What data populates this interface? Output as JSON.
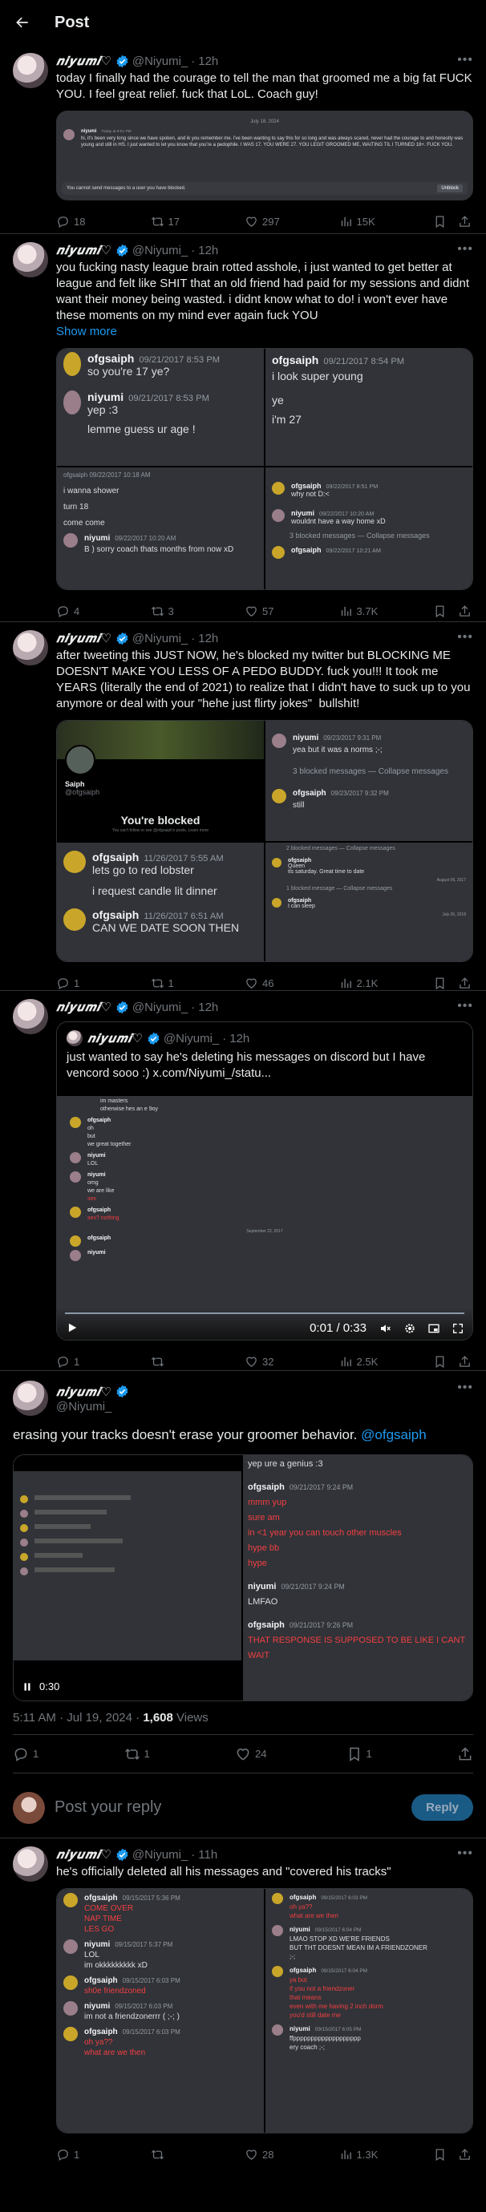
{
  "header": {
    "title": "Post"
  },
  "user": {
    "name": "𝒏𝒊𝒚𝒖𝒎𝒊♡",
    "handle": "@Niyumi_"
  },
  "t1": {
    "time": "12h",
    "text": "today I finally had the courage to tell the man that groomed me a big fat FUCK YOU. I feel great relief. fuck that LoL. Coach guy!",
    "date_divider": "July 18, 2024",
    "dm_user": "niyumi",
    "dm_ts": "Today at 9:01 PM",
    "dm_msg": "hi, it's been very long since we have spoken, and ik you remember me. i've been wanting to say this for so long and was always scared, never had the courage to and honestly was young and still in HS. I just wanted to let you know that you're a pedophile. I WAS 17. YOU WERE 27. YOU LEGIT GROOMED ME, WAITING TIL I TURNED 18+. FUCK YOU.",
    "blocked": "You cannot send messages to a user you have blocked.",
    "unblock": "Unblock",
    "replies": "18",
    "reposts": "17",
    "likes": "297",
    "views": "15K"
  },
  "t2": {
    "time": "12h",
    "text": "you fucking nasty league brain rotted asshole, i just wanted to get better at league and felt like SHIT that an old friend had paid for my sessions and didnt want their money being wasted. i didnt know what to do! i won't ever have these moments on my mind ever again fuck YOU",
    "show_more": "Show more",
    "q1": {
      "u1": "ofgsaiph",
      "ts1": "09/21/2017 8:53 PM",
      "m1": "so you're 17 ye?",
      "u2": "niyumi",
      "ts2": "09/21/2017 8:53 PM",
      "m2": "yep :3",
      "m3": "lemme guess ur age !"
    },
    "q2": {
      "u": "ofgsaiph",
      "ts": "09/21/2017 8:54 PM",
      "m1": "i look super young",
      "m2": "ye",
      "m3": "i'm 27"
    },
    "q3": {
      "head": "ofgsaiph   09/22/2017 10:18 AM",
      "m1": "i wanna shower",
      "m2": "turn 18",
      "m3": "come come",
      "u": "niyumi",
      "ts": "09/22/2017 10:20 AM",
      "m4": "B ) sorry coach thats months from now xD"
    },
    "q4": {
      "u1": "ofgsaiph",
      "ts1": "09/22/2017 8:51 PM",
      "m1": "why not D:<",
      "u2": "niyumi",
      "ts2": "09/22/2017 10:20 AM",
      "m2": "wouldnt have a way home xD",
      "sys": "3 blocked messages — Collapse messages",
      "u3": "ofgsaiph",
      "ts3": "09/22/2017 10:21 AM"
    },
    "replies": "4",
    "reposts": "3",
    "likes": "57",
    "views": "3.7K"
  },
  "t3": {
    "time": "12h",
    "text": "after tweeting this JUST NOW, he's blocked my twitter but BLOCKING ME DOESN'T MAKE YOU LESS OF A PEDO BUDDY. fuck you!!! It took me YEARS (literally the end of 2021) to realize that I didn't have to suck up to you anymore or deal with your \"hehe just flirty jokes\"  bullshit!",
    "profile_name": "Saiph",
    "profile_handle": "@ofgsaiph",
    "you_blocked": "You're blocked",
    "blocked_sub": "You can't follow or see @ofgsaiph's posts. Learn more",
    "q2": {
      "u1": "niyumi",
      "ts1": "09/23/2017 9:31 PM",
      "m1": "yea but it was a norms ;-;",
      "sys": "3 blocked messages — Collapse messages",
      "u2": "ofgsaiph",
      "ts2": "09/23/2017 9:32 PM",
      "m2": "still"
    },
    "q3": {
      "u": "ofgsaiph",
      "ts": "11/26/2017 5:55 AM",
      "m1": "lets go to red lobster",
      "m2": "i request candle lit dinner",
      "u2": "ofgsaiph",
      "ts2": "11/26/2017 6:51 AM",
      "m3": "CAN WE DATE SOON THEN"
    },
    "q4": {
      "sys1": "2 blocked messages — Collapse messages",
      "u1": "ofgsaiph",
      "m1": "Queen",
      "m2": "its saturday. Great time to date",
      "d1": "August 06, 2017",
      "sys2": "1 blocked message — Collapse messages",
      "u2": "ofgsaiph",
      "m3": "I can sleep",
      "d2": "July 26, 2018"
    },
    "replies": "1",
    "reposts": "1",
    "likes": "46",
    "views": "2.1K"
  },
  "t4": {
    "time": "12h",
    "quote_time": "12h",
    "quote_text": "just wanted to say he's deleting his messages on discord but I have vencord sooo :) x.com/Niyumi_/statu...",
    "v": {
      "l1": "im masters",
      "l2": "otherwise hes an e 9oy",
      "u1": "ofgsaiph",
      "m1": "oh",
      "m2": "but",
      "m3": "we great together",
      "u2": "niyumi",
      "m4": "LOL",
      "u3": "niyumi",
      "m5": "omg",
      "m6": "we are like",
      "m7": "sex",
      "u4": "ofgsaiph",
      "m8": "sex? nothing",
      "d": "September 22, 2017",
      "u5": "ofgsaiph",
      "u6": "niyumi"
    },
    "video_time": "0:01 / 0:33",
    "replies": "1",
    "reposts": "",
    "likes": "32",
    "views": "2.5K"
  },
  "t5": {
    "text": "erasing your tracks doesn't erase your groomer behavior. ",
    "mention": "@ofgsaiph",
    "video_time": "0:30",
    "right": {
      "top": "yep ure a genius :3",
      "u1": "ofgsaiph",
      "ts1": "09/21/2017 9:24 PM",
      "m1": "mmm yup",
      "m2": "sure am",
      "m3": "in <1 year you can touch other muscles",
      "m4": "hype bb",
      "m5": "hype",
      "u2": "niyumi",
      "ts2": "09/21/2017 9:24 PM",
      "m6": "LMFAO",
      "u3": "ofgsaiph",
      "ts3": "09/21/2017 9:26 PM",
      "m7": "THAT RESPONSE IS SUPPOSED TO BE LIKE I CANT WAIT"
    },
    "stats_time": "5:11 AM · Jul 19, 2024 · ",
    "stats_views": "1,608",
    "stats_views_label": " Views",
    "replies": "1",
    "reposts": "1",
    "likes": "24",
    "bookmarks": "1"
  },
  "reply": {
    "placeholder": "Post your reply",
    "button": "Reply"
  },
  "t6": {
    "time": "11h",
    "text": "he's officially deleted all his messages and \"covered his tracks\"",
    "left": [
      {
        "u": "ofgsaiph",
        "ts": "09/15/2017 5:36 PM",
        "lines": [
          "COME OVER",
          "NAP TIME",
          "LES GO"
        ],
        "red": true
      },
      {
        "u": "niyumi",
        "ts": "09/15/2017 5:37 PM",
        "lines": [
          "LOL",
          "im okkkkkkkkk xD"
        ],
        "red": false
      },
      {
        "u": "ofgsaiph",
        "ts": "09/15/2017 6:03 PM",
        "lines": [
          "sh0e friendzoned"
        ],
        "red": true
      },
      {
        "u": "niyumi",
        "ts": "09/15/2017 6:03 PM",
        "lines": [
          "im not a friendzonerrr ( ;-; )"
        ],
        "red": false
      },
      {
        "u": "ofgsaiph",
        "ts": "09/15/2017 6:03 PM",
        "lines": [
          "oh ya??",
          "what are we then"
        ],
        "red": true
      }
    ],
    "right": [
      {
        "u": "ofgsaiph",
        "ts": "09/15/2017 6:03 PM",
        "lines": [
          "oh ya??",
          "what are we then"
        ],
        "red": true
      },
      {
        "u": "niyumi",
        "ts": "09/15/2017 6:04 PM",
        "lines": [
          "LMAO STOP XD WE'RE FRIENDS",
          "BUT THT DOESNT MEAN IM A FRIENDZONER",
          ";-;"
        ],
        "red": false
      },
      {
        "u": "ofgsaiph",
        "ts": "09/15/2017 6:04 PM",
        "lines": [
          "ya but",
          "if you not a friendzoner",
          "that means",
          "even with me having 2 inch dorm",
          "you'd still date me"
        ],
        "red": true
      },
      {
        "u": "niyumi",
        "ts": "09/15/2017 6:05 PM",
        "lines": [
          "ffppppppppppppppppppp",
          "ery coach ;-;"
        ],
        "red": false
      }
    ],
    "replies": "1",
    "reposts": "",
    "likes": "28",
    "views": "1.3K"
  }
}
